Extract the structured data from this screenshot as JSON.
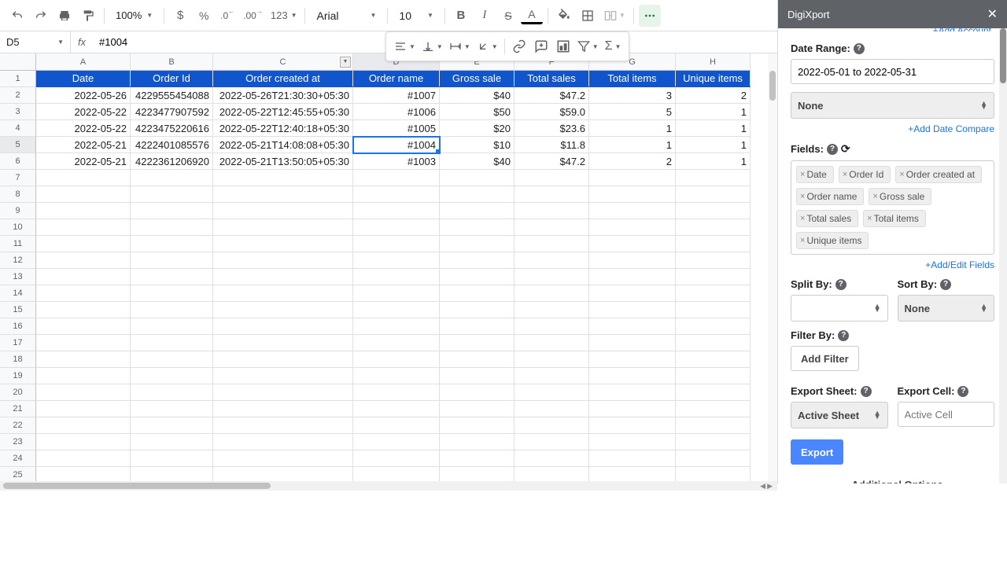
{
  "toolbar": {
    "zoom": "100%",
    "ext_text": "123",
    "font_family": "Arial",
    "font_size": "10"
  },
  "namebox": "D5",
  "formula": "#1004",
  "columns": [
    "A",
    "B",
    "C",
    "D",
    "E",
    "F",
    "G",
    "H"
  ],
  "headers": [
    "Date",
    "Order Id",
    "Order created at",
    "Order name",
    "Gross sale",
    "Total sales",
    "Total items",
    "Unique items"
  ],
  "rows": [
    {
      "date": "2022-05-26",
      "order_id": "4229555454088",
      "created": "2022-05-26T21:30:30+05:30",
      "name": "#1007",
      "gross": "$40",
      "total": "$47.2",
      "items": "3",
      "unique": "2"
    },
    {
      "date": "2022-05-22",
      "order_id": "4223477907592",
      "created": "2022-05-22T12:45:55+05:30",
      "name": "#1006",
      "gross": "$50",
      "total": "$59.0",
      "items": "5",
      "unique": "1"
    },
    {
      "date": "2022-05-22",
      "order_id": "4223475220616",
      "created": "2022-05-22T12:40:18+05:30",
      "name": "#1005",
      "gross": "$20",
      "total": "$23.6",
      "items": "1",
      "unique": "1"
    },
    {
      "date": "2022-05-21",
      "order_id": "4222401085576",
      "created": "2022-05-21T14:08:08+05:30",
      "name": "#1004",
      "gross": "$10",
      "total": "$11.8",
      "items": "1",
      "unique": "1"
    },
    {
      "date": "2022-05-21",
      "order_id": "4222361206920",
      "created": "2022-05-21T13:50:05+05:30",
      "name": "#1003",
      "gross": "$40",
      "total": "$47.2",
      "items": "2",
      "unique": "1"
    }
  ],
  "sidepanel": {
    "title": "DigiXport",
    "add_account": "+Add Account",
    "date_range_label": "Date Range:",
    "date_range_value": "2022-05-01 to 2022-05-31",
    "compare_none": "None",
    "add_date_compare": "+Add Date Compare",
    "fields_label": "Fields:",
    "fields": [
      "Date",
      "Order Id",
      "Order created at",
      "Order name",
      "Gross sale",
      "Total sales",
      "Total items",
      "Unique items"
    ],
    "add_edit_fields": "+Add/Edit Fields",
    "split_by_label": "Split By:",
    "sort_by_label": "Sort By:",
    "sort_by_value": "None",
    "filter_by_label": "Filter By:",
    "add_filter": "Add Filter",
    "export_sheet_label": "Export Sheet:",
    "export_sheet_value": "Active Sheet",
    "export_cell_label": "Export Cell:",
    "export_cell_placeholder": "Active Cell",
    "export_btn": "Export",
    "additional": "Additional Options"
  }
}
